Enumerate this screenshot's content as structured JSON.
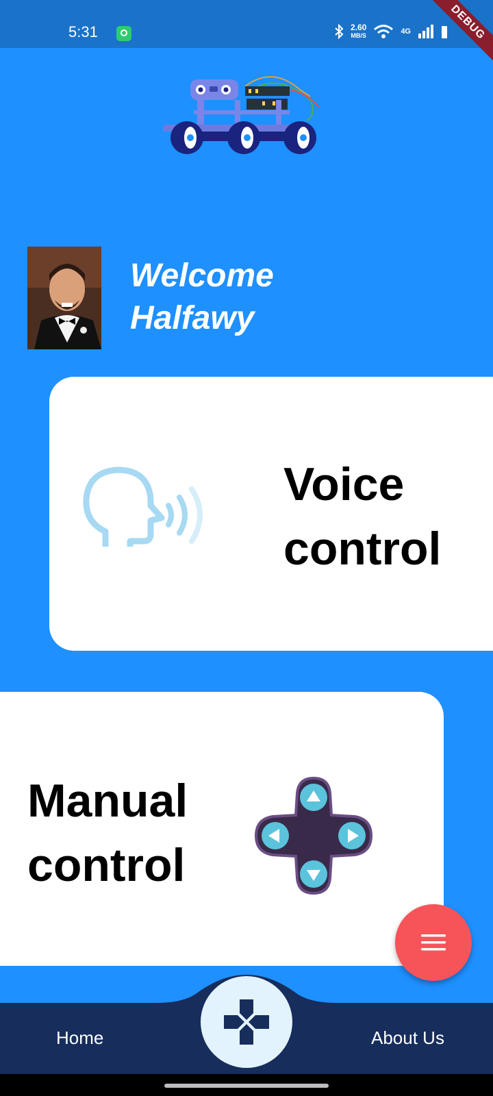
{
  "status_bar": {
    "time": "5:31",
    "net_speed_value": "2.60",
    "net_speed_unit": "MB/S",
    "network_type": "4G",
    "debug_label": "DEBUG"
  },
  "welcome": {
    "line1": "Welcome",
    "line2": "Halfawy"
  },
  "voice_card": {
    "line1": "Voice",
    "line2": "control"
  },
  "manual_card": {
    "line1": "Manual",
    "line2": "control"
  },
  "bottom_nav": {
    "home_label": "Home",
    "about_label": "About Us"
  },
  "colors": {
    "background": "#1E90FF",
    "status_bar": "#1A73C9",
    "nav_bar": "#172D5C",
    "fab": "#F7545A",
    "card": "#FFFFFF"
  },
  "icons": {
    "robot_logo": "robot-car-icon",
    "voice": "speaking-head-icon",
    "manual": "gamepad-dpad-icon",
    "fab": "hamburger-menu-icon",
    "center_button": "dpad-cross-icon"
  }
}
